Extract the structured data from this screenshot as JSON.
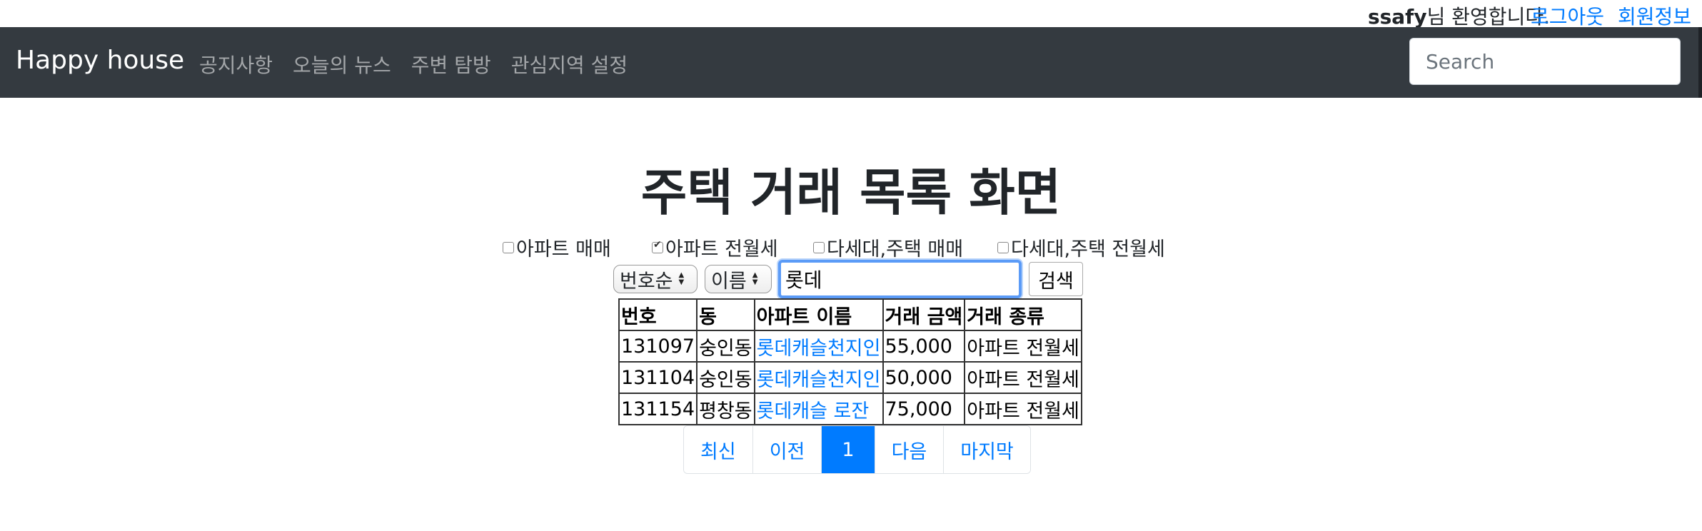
{
  "header": {
    "user": "ssafy",
    "greeting_suffix": "님 환영합니다.",
    "logout_label": "로그아웃",
    "member_info_label": "회원정보"
  },
  "navbar": {
    "brand": "Happy house",
    "links": [
      "공지사항",
      "오늘의 뉴스",
      "주변 탐방",
      "관심지역 설정"
    ],
    "search_placeholder": "Search"
  },
  "main": {
    "title": "주택 거래 목록 화면",
    "filters": [
      {
        "label": "아파트 매매",
        "checked": false
      },
      {
        "label": "아파트 전월세",
        "checked": true
      },
      {
        "label": "다세대,주택 매매",
        "checked": false
      },
      {
        "label": "다세대,주택 전월세",
        "checked": false
      }
    ],
    "sort_select": "번호순",
    "field_select": "이름",
    "keyword": "롯데",
    "search_button": "검색",
    "table": {
      "headers": [
        "번호",
        "동",
        "아파트 이름",
        "거래 금액",
        "거래 종류"
      ],
      "rows": [
        [
          "131097",
          "숭인동",
          "롯데캐슬천지인",
          "55,000",
          "아파트 전월세"
        ],
        [
          "131104",
          "숭인동",
          "롯데캐슬천지인",
          "50,000",
          "아파트 전월세"
        ],
        [
          "131154",
          "평창동",
          "롯데캐슬 로잔",
          "75,000",
          "아파트 전월세"
        ]
      ]
    },
    "pagination": [
      "최신",
      "이전",
      "1",
      "다음",
      "마지막"
    ]
  },
  "colors": {
    "navbar_bg": "#343a40",
    "link": "#007bff",
    "active_page_bg": "#007bff"
  }
}
